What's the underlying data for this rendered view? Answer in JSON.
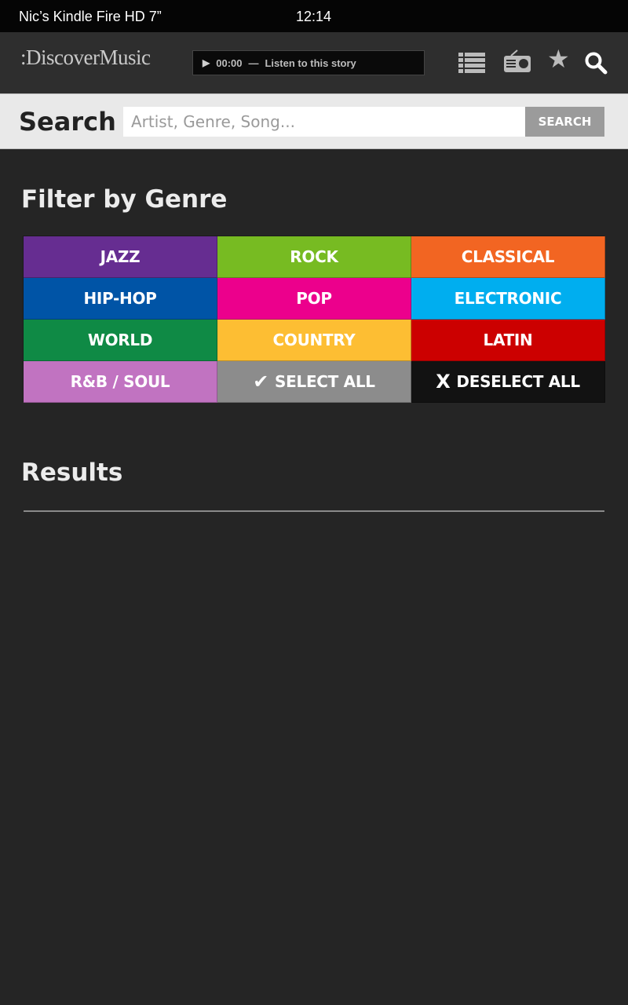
{
  "status_bar": {
    "device": "Nic’s Kindle Fire HD 7”",
    "time": "12:14"
  },
  "header": {
    "logo_text": ":DiscoverMusic",
    "player": {
      "play_icon": "play-icon",
      "time": "00:00",
      "dash": "—",
      "label": "Listen to this story"
    },
    "icons": [
      "list-icon",
      "radio-icon",
      "star-icon",
      "search-icon"
    ]
  },
  "search": {
    "title": "Search",
    "placeholder": "Artist, Genre, Song...",
    "value": "",
    "button_label": "SEARCH"
  },
  "filter": {
    "title": "Filter by Genre",
    "genres": [
      {
        "label": "JAZZ",
        "color": "#662d91"
      },
      {
        "label": "ROCK",
        "color": "#77bb22"
      },
      {
        "label": "CLASSICAL",
        "color": "#f26522"
      },
      {
        "label": "HIP-HOP",
        "color": "#0054a6"
      },
      {
        "label": "POP",
        "color": "#ec008c"
      },
      {
        "label": "ELECTRONIC",
        "color": "#00aeef"
      },
      {
        "label": "WORLD",
        "color": "#0f8a45"
      },
      {
        "label": "COUNTRY",
        "color": "#fdbe33"
      },
      {
        "label": "LATIN",
        "color": "#cc0000"
      },
      {
        "label": "R&B / SOUL",
        "color": "#c173c1"
      }
    ],
    "select_all": {
      "label": "SELECT ALL",
      "icon": "checkmark-icon",
      "glyph": "✔",
      "color": "#8c8c8c"
    },
    "deselect_all": {
      "label": "DESELECT ALL",
      "icon": "x-icon",
      "glyph": "X",
      "color": "#121212"
    }
  },
  "results": {
    "title": "Results"
  }
}
